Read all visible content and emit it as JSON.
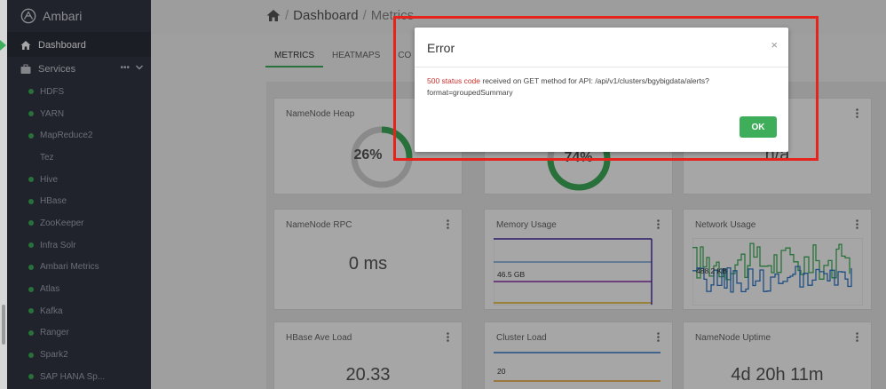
{
  "app": {
    "name": "Ambari"
  },
  "sidebar": {
    "dashboard": "Dashboard",
    "services_header": "Services",
    "services": [
      {
        "label": "HDFS",
        "status": "green"
      },
      {
        "label": "YARN",
        "status": "green"
      },
      {
        "label": "MapReduce2",
        "status": "green"
      },
      {
        "label": "Tez",
        "status": "none"
      },
      {
        "label": "Hive",
        "status": "green"
      },
      {
        "label": "HBase",
        "status": "green"
      },
      {
        "label": "ZooKeeper",
        "status": "green"
      },
      {
        "label": "Infra Solr",
        "status": "green"
      },
      {
        "label": "Ambari Metrics",
        "status": "green"
      },
      {
        "label": "Atlas",
        "status": "green"
      },
      {
        "label": "Kafka",
        "status": "green"
      },
      {
        "label": "Ranger",
        "status": "green"
      },
      {
        "label": "Spark2",
        "status": "green"
      },
      {
        "label": "SAP HANA Sp...",
        "status": "green"
      }
    ]
  },
  "breadcrumb": {
    "sep": "/",
    "dashboard": "Dashboard",
    "current": "Metrics"
  },
  "tabs": [
    "METRICS",
    "HEATMAPS",
    "CO"
  ],
  "widgets": {
    "namenode_heap": {
      "title": "NameNode Heap",
      "value": "26%",
      "percent": 26
    },
    "hidden_gauge": {
      "value": "74%",
      "percent": 74
    },
    "hidden_value": {
      "value": "n/a"
    },
    "namenode_rpc": {
      "title": "NameNode RPC",
      "value": "0 ms"
    },
    "memory_usage": {
      "title": "Memory Usage",
      "label": "46.5 GB"
    },
    "network_usage": {
      "title": "Network Usage",
      "label": "488.2 KB"
    },
    "hbase_ave_load": {
      "title": "HBase Ave Load",
      "value": "20.33"
    },
    "cluster_load": {
      "title": "Cluster Load",
      "label": "20"
    },
    "namenode_uptime": {
      "title": "NameNode Uptime",
      "value": "4d 20h 11m"
    }
  },
  "modal": {
    "title": "Error",
    "close": "×",
    "code": "500 status code",
    "message_rest": " received on GET method for API: /api/v1/clusters/bgybigdata/alerts?format=groupedSummary",
    "ok": "OK"
  },
  "colors": {
    "sidebar": "#323544",
    "accent_green": "#3fae5a",
    "error_red": "#c9302c",
    "highlight": "#e5241d"
  }
}
